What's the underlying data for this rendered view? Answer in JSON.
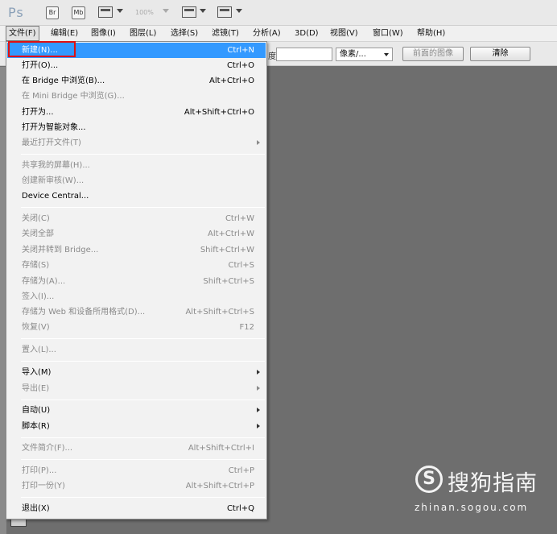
{
  "appbar": {
    "logo": "Ps",
    "br_label": "Br",
    "mb_label": "Mb",
    "zoom": "100%"
  },
  "menubar": {
    "items": [
      "文件(F)",
      "编辑(E)",
      "图像(I)",
      "图层(L)",
      "选择(S)",
      "滤镜(T)",
      "分析(A)",
      "3D(D)",
      "视图(V)",
      "窗口(W)",
      "帮助(H)"
    ]
  },
  "options": {
    "partial_label": "度:",
    "unit_select": "像素/...",
    "front_image_button": "前面的图像",
    "clear_button": "清除"
  },
  "file_menu": {
    "items": [
      {
        "label": "新建(N)...",
        "shortcut": "Ctrl+N"
      },
      {
        "label": "打开(O)...",
        "shortcut": "Ctrl+O"
      },
      {
        "label": "在 Bridge 中浏览(B)...",
        "shortcut": "Alt+Ctrl+O"
      },
      {
        "label": "在 Mini Bridge 中浏览(G)...",
        "shortcut": ""
      },
      {
        "label": "打开为...",
        "shortcut": "Alt+Shift+Ctrl+O"
      },
      {
        "label": "打开为智能对象...",
        "shortcut": ""
      },
      {
        "label": "最近打开文件(T)",
        "shortcut": ""
      },
      {
        "label": "共享我的屏幕(H)...",
        "shortcut": ""
      },
      {
        "label": "创建新审核(W)...",
        "shortcut": ""
      },
      {
        "label": "Device Central...",
        "shortcut": ""
      },
      {
        "label": "关闭(C)",
        "shortcut": "Ctrl+W"
      },
      {
        "label": "关闭全部",
        "shortcut": "Alt+Ctrl+W"
      },
      {
        "label": "关闭并转到 Bridge...",
        "shortcut": "Shift+Ctrl+W"
      },
      {
        "label": "存储(S)",
        "shortcut": "Ctrl+S"
      },
      {
        "label": "存储为(A)...",
        "shortcut": "Shift+Ctrl+S"
      },
      {
        "label": "签入(I)...",
        "shortcut": ""
      },
      {
        "label": "存储为 Web 和设备所用格式(D)...",
        "shortcut": "Alt+Shift+Ctrl+S"
      },
      {
        "label": "恢复(V)",
        "shortcut": "F12"
      },
      {
        "label": "置入(L)...",
        "shortcut": ""
      },
      {
        "label": "导入(M)",
        "shortcut": ""
      },
      {
        "label": "导出(E)",
        "shortcut": ""
      },
      {
        "label": "自动(U)",
        "shortcut": ""
      },
      {
        "label": "脚本(R)",
        "shortcut": ""
      },
      {
        "label": "文件简介(F)...",
        "shortcut": "Alt+Shift+Ctrl+I"
      },
      {
        "label": "打印(P)...",
        "shortcut": "Ctrl+P"
      },
      {
        "label": "打印一份(Y)",
        "shortcut": "Alt+Shift+Ctrl+P"
      },
      {
        "label": "退出(X)",
        "shortcut": "Ctrl+Q"
      }
    ]
  },
  "watermark": {
    "icon_letter": "S",
    "title": "搜狗指南",
    "url": "zhinan.sogou.com"
  },
  "colors": {
    "highlight": "#3399ff",
    "annotation_box": "#e01010",
    "workspace": "#6e6e6e"
  }
}
